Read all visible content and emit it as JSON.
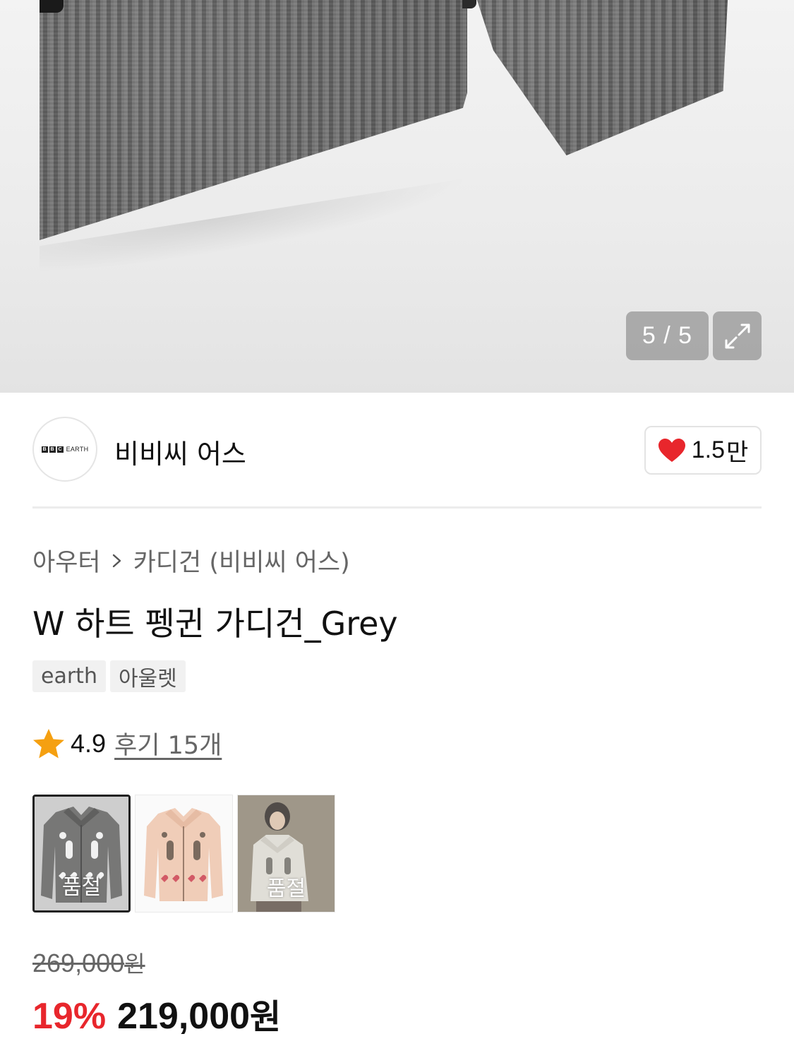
{
  "gallery": {
    "counter": "5 / 5",
    "expand_icon": "expand-arrows-icon"
  },
  "brand": {
    "logo_text": "BBC EARTH",
    "logo_letters": [
      "B",
      "B",
      "C"
    ],
    "logo_word": "EARTH",
    "name": "비비씨 어스",
    "like_count": "1.5",
    "like_suffix": "만",
    "like_icon": "heart-icon",
    "like_color": "#e8262c"
  },
  "category": {
    "parent": "아우터",
    "child": "카디건 (비비씨 어스)"
  },
  "product": {
    "title": "W 하트 펭귄 가디건_Grey",
    "tags": [
      "earth",
      "아울렛"
    ]
  },
  "rating": {
    "score": "4.9",
    "reviews": "후기 15개",
    "star_color": "#f5a011"
  },
  "options": [
    {
      "label": "품절",
      "selected": true,
      "soldout": true
    },
    {
      "label": "",
      "selected": false,
      "soldout": false
    },
    {
      "label": "품절",
      "selected": false,
      "soldout": true
    }
  ],
  "price": {
    "original": "269,000",
    "original_unit": "원",
    "discount": "19%",
    "sale": "219,000",
    "sale_unit": "원",
    "discount_color": "#e8262c"
  }
}
